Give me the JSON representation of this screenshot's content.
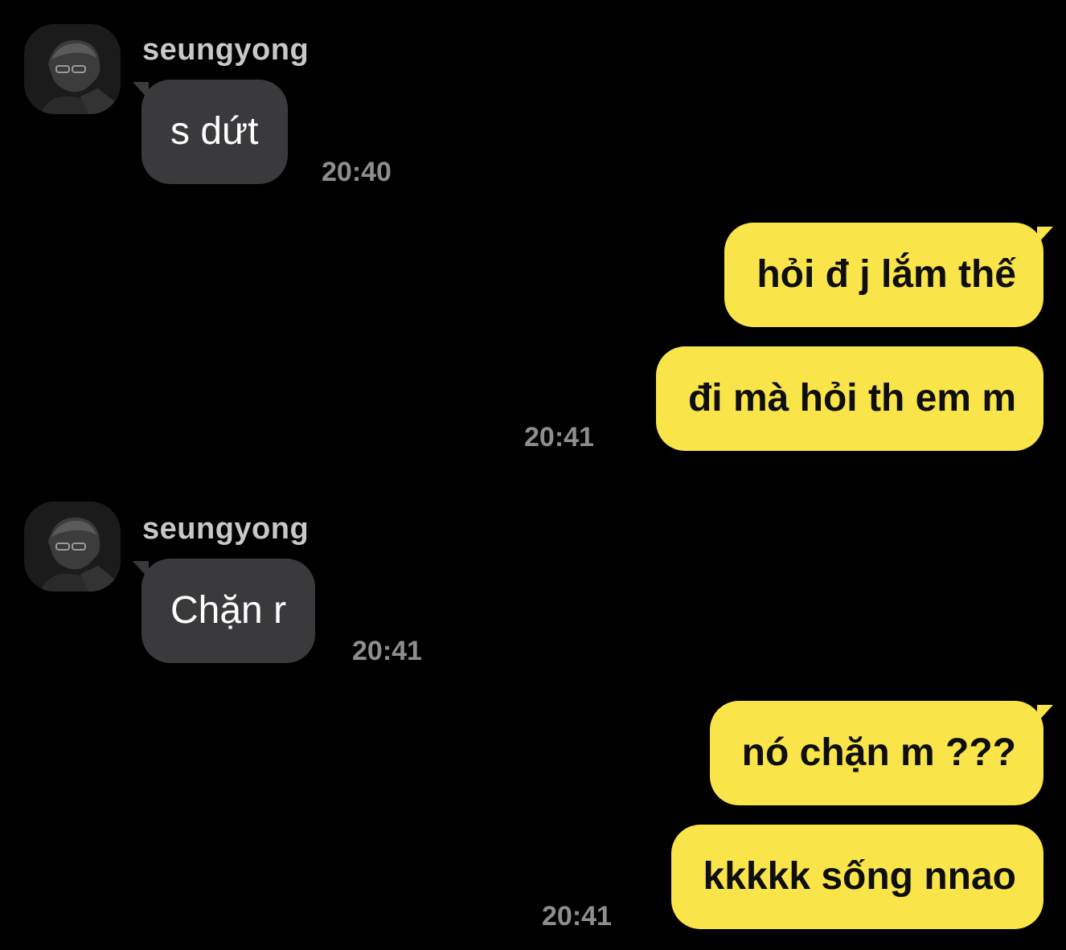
{
  "messages": [
    {
      "sender": "seungyong",
      "direction": "incoming",
      "text": "s dứt",
      "time": "20:40"
    },
    {
      "direction": "outgoing",
      "text": "hỏi đ j lắm thế"
    },
    {
      "direction": "outgoing",
      "text": "đi mà hỏi th em m",
      "time": "20:41"
    },
    {
      "sender": "seungyong",
      "direction": "incoming",
      "text": "Chặn r",
      "time": "20:41"
    },
    {
      "direction": "outgoing",
      "text": "nó chặn m ???"
    },
    {
      "direction": "outgoing",
      "text": "kkkkk sống nnao",
      "time": "20:41"
    }
  ],
  "colors": {
    "background": "#000000",
    "incoming_bubble": "#3a3a3c",
    "outgoing_bubble": "#f9e44a",
    "timestamp": "#8e8e8e",
    "sender_name": "#c8c8c8"
  },
  "icons": {
    "avatar": "profile-photo-avatar"
  }
}
